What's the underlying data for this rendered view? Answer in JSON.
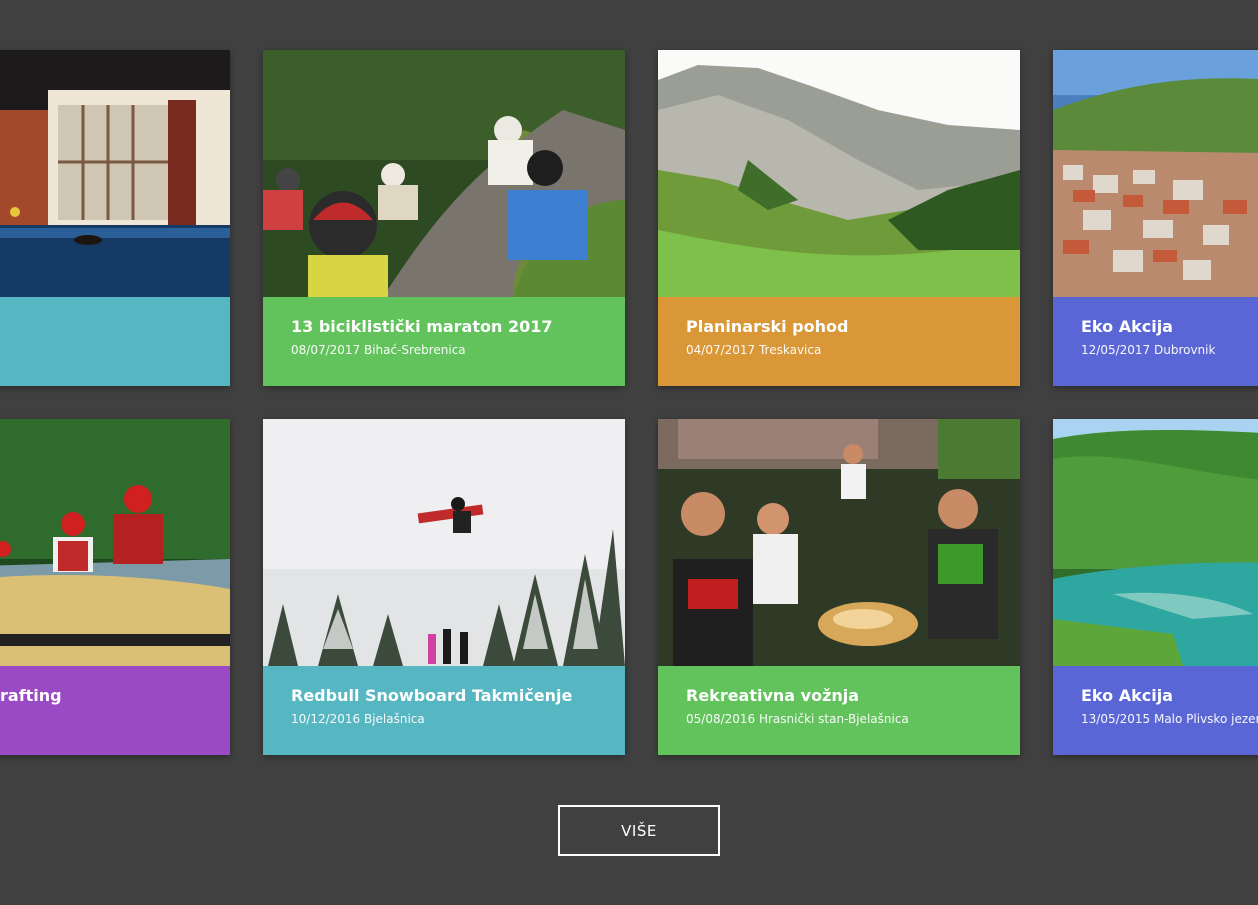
{
  "cards": [
    {
      "title": "",
      "meta": "",
      "color": "#56b6c1",
      "photo": "pool-icon"
    },
    {
      "title": "13 biciklistički maraton 2017",
      "meta": "08/07/2017 Bihać-Srebrenica",
      "color": "#62c35c",
      "photo": "cyclists-icon"
    },
    {
      "title": "Planinarski pohod",
      "meta": "04/07/2017 Treskavica",
      "color": "#d99737",
      "photo": "mountain-icon"
    },
    {
      "title": "Eko Akcija",
      "meta": "12/05/2017 Dubrovnik",
      "color": "#5b66d6",
      "photo": "city-icon"
    },
    {
      "title": "rafting",
      "meta": "",
      "color": "#9a4ac4",
      "photo": "rafting-icon"
    },
    {
      "title": "Redbull Snowboard Takmičenje",
      "meta": "10/12/2016 Bjelašnica",
      "color": "#56b6c1",
      "photo": "snowboard-icon"
    },
    {
      "title": "Rekreativna vožnja",
      "meta": "05/08/2016 Hrasnički stan-Bjelašnica",
      "color": "#62c35c",
      "photo": "picnic-icon"
    },
    {
      "title": "Eko Akcija",
      "meta": "13/05/2015 Malo Plivsko jezero",
      "color": "#5b66d6",
      "photo": "lake-icon"
    }
  ],
  "more_button": {
    "label": "VIŠE"
  }
}
